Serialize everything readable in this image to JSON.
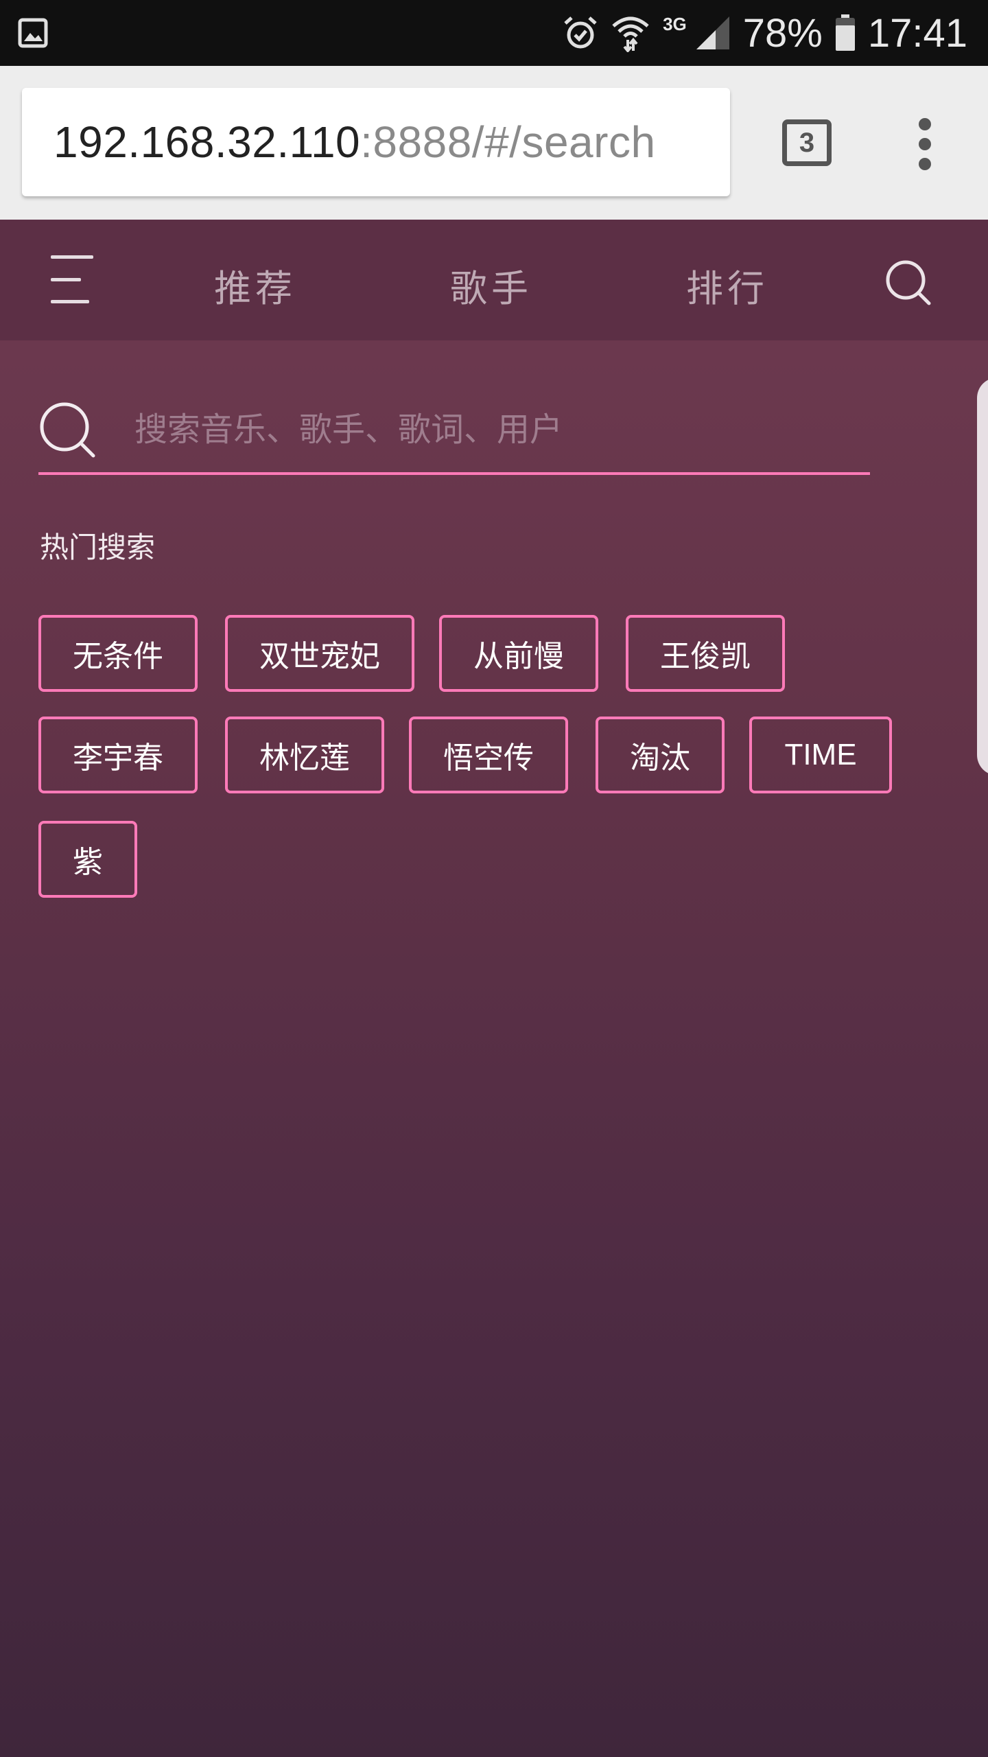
{
  "status_bar": {
    "network_label": "3G",
    "battery": "78%",
    "time": "17:41"
  },
  "browser": {
    "url_host": "192.168.32.110",
    "url_path": ":8888/#/search",
    "tab_count": "3"
  },
  "app": {
    "nav": {
      "tabs": [
        "推荐",
        "歌手",
        "排行"
      ]
    },
    "search": {
      "placeholder": "搜索音乐、歌手、歌词、用户",
      "value": ""
    },
    "hot_search": {
      "title": "热门搜索",
      "tags": [
        "无条件",
        "双世宠妃",
        "从前慢",
        "王俊凯",
        "李宇春",
        "林忆莲",
        "悟空传",
        "淘汰",
        "TIME",
        "紫"
      ]
    }
  },
  "colors": {
    "accent": "#ff7ab8",
    "header_bg": "#5c2f45",
    "app_bg_top": "#6e3a50",
    "app_bg_bottom": "#3f263b"
  },
  "icons": {
    "status_left": "gallery-icon",
    "status_right": [
      "alarm-icon",
      "wifi-icon",
      "signal-icon",
      "battery-icon"
    ],
    "browser": [
      "tabs-icon",
      "overflow-menu-icon"
    ],
    "header": [
      "hamburger-menu-icon",
      "search-icon"
    ],
    "search_field": "search-icon"
  }
}
